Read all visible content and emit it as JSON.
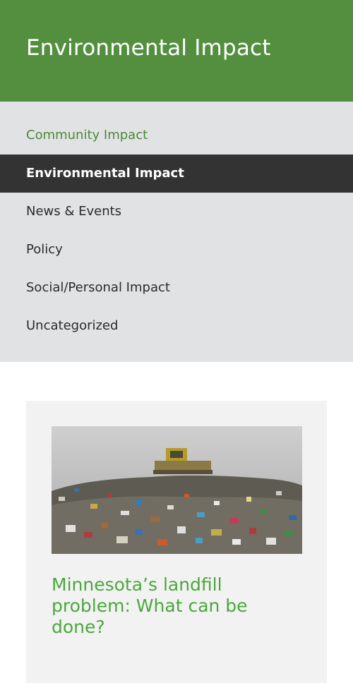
{
  "header": {
    "title": "Environmental Impact"
  },
  "menu": {
    "items": [
      {
        "label": "Community Impact"
      },
      {
        "label": "Environmental Impact"
      },
      {
        "label": "News & Events"
      },
      {
        "label": "Policy"
      },
      {
        "label": "Social/Personal Impact"
      },
      {
        "label": "Uncategorized"
      }
    ]
  },
  "post": {
    "title": "Minnesota’s landfill problem: What can be done?",
    "image_description": "landfill-photo"
  },
  "colors": {
    "header_bg": "#538f3f",
    "menu_bg": "#e1e2e4",
    "active_bg": "#333333",
    "accent_green": "#4aa83c"
  }
}
